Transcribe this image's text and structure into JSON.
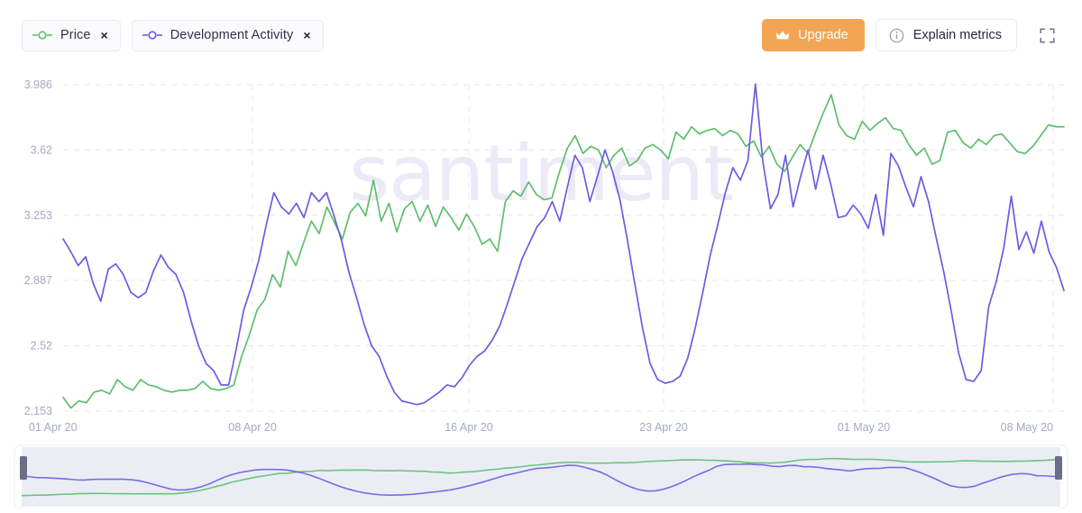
{
  "toolbar": {
    "chips": [
      {
        "label": "Price",
        "color": "#5fbe6e",
        "marker_icon": "line-point-icon",
        "close_icon": "close-icon",
        "close_label": "×"
      },
      {
        "label": "Development Activity",
        "color": "#6e5ce0",
        "marker_icon": "line-point-icon",
        "close_icon": "close-icon",
        "close_label": "×"
      }
    ],
    "upgrade": {
      "label": "Upgrade",
      "icon": "crown-icon",
      "bg": "#f2a455",
      "fg": "#ffffff"
    },
    "explain": {
      "label": "Explain metrics",
      "icon": "info-circle-icon"
    },
    "fullscreen": {
      "icon": "fullscreen-icon",
      "label": ""
    }
  },
  "watermark": "santiment",
  "chart_data": {
    "type": "line",
    "title": "",
    "xlabel": "",
    "ylabel": "",
    "grid": true,
    "legend_position": "top-left",
    "y_ticks": [
      "3.986",
      "3.62",
      "3.253",
      "2.887",
      "2.52",
      "2.153"
    ],
    "ylim": [
      2.153,
      3.986
    ],
    "x_ticks": [
      "01 Apr 20",
      "08 Apr 20",
      "16 Apr 20",
      "23 Apr 20",
      "01 May 20",
      "08 May 20"
    ],
    "x_tick_positions": [
      0,
      0.1892,
      0.4054,
      0.6,
      0.8,
      0.9892
    ],
    "series": [
      {
        "name": "Price",
        "color": "#5fbe6e",
        "values": [
          2.23,
          2.17,
          2.21,
          2.2,
          2.26,
          2.27,
          2.25,
          2.33,
          2.29,
          2.27,
          2.33,
          2.3,
          2.29,
          2.27,
          2.26,
          2.27,
          2.27,
          2.28,
          2.32,
          2.28,
          2.27,
          2.28,
          2.3,
          2.46,
          2.58,
          2.72,
          2.78,
          2.92,
          2.85,
          3.05,
          2.97,
          3.1,
          3.22,
          3.15,
          3.3,
          3.21,
          3.12,
          3.27,
          3.32,
          3.25,
          3.45,
          3.22,
          3.32,
          3.16,
          3.29,
          3.33,
          3.22,
          3.31,
          3.19,
          3.3,
          3.24,
          3.17,
          3.26,
          3.19,
          3.09,
          3.12,
          3.05,
          3.33,
          3.39,
          3.36,
          3.44,
          3.37,
          3.34,
          3.35,
          3.5,
          3.63,
          3.7,
          3.6,
          3.64,
          3.62,
          3.52,
          3.59,
          3.63,
          3.53,
          3.56,
          3.63,
          3.65,
          3.62,
          3.57,
          3.72,
          3.68,
          3.75,
          3.71,
          3.73,
          3.74,
          3.7,
          3.73,
          3.71,
          3.64,
          3.67,
          3.58,
          3.64,
          3.54,
          3.5,
          3.58,
          3.65,
          3.6,
          3.72,
          3.83,
          3.93,
          3.76,
          3.7,
          3.68,
          3.78,
          3.73,
          3.77,
          3.8,
          3.74,
          3.73,
          3.65,
          3.59,
          3.63,
          3.54,
          3.56,
          3.72,
          3.73,
          3.66,
          3.63,
          3.68,
          3.65,
          3.7,
          3.71,
          3.66,
          3.61,
          3.6,
          3.64,
          3.7,
          3.76,
          3.75,
          3.75
        ]
      },
      {
        "name": "Development Activity",
        "color": "#6e5ce0",
        "values": [
          3.12,
          3.05,
          2.97,
          3.02,
          2.87,
          2.77,
          2.95,
          2.98,
          2.92,
          2.82,
          2.79,
          2.82,
          2.94,
          3.03,
          2.96,
          2.92,
          2.82,
          2.66,
          2.52,
          2.42,
          2.38,
          2.3,
          2.3,
          2.5,
          2.72,
          2.85,
          3.0,
          3.2,
          3.38,
          3.3,
          3.26,
          3.32,
          3.24,
          3.38,
          3.33,
          3.38,
          3.25,
          3.11,
          2.93,
          2.79,
          2.64,
          2.52,
          2.46,
          2.35,
          2.26,
          2.21,
          2.2,
          2.19,
          2.2,
          2.23,
          2.26,
          2.3,
          2.29,
          2.34,
          2.41,
          2.46,
          2.49,
          2.55,
          2.63,
          2.75,
          2.88,
          3.01,
          3.1,
          3.19,
          3.24,
          3.33,
          3.22,
          3.41,
          3.59,
          3.52,
          3.33,
          3.47,
          3.62,
          3.5,
          3.34,
          3.11,
          2.86,
          2.62,
          2.42,
          2.33,
          2.31,
          2.32,
          2.35,
          2.45,
          2.62,
          2.82,
          3.03,
          3.2,
          3.38,
          3.52,
          3.45,
          3.56,
          3.99,
          3.55,
          3.29,
          3.37,
          3.59,
          3.3,
          3.47,
          3.62,
          3.4,
          3.59,
          3.43,
          3.24,
          3.25,
          3.31,
          3.26,
          3.18,
          3.37,
          3.14,
          3.6,
          3.53,
          3.41,
          3.3,
          3.47,
          3.33,
          3.13,
          2.94,
          2.72,
          2.48,
          2.33,
          2.32,
          2.38,
          2.74,
          2.88,
          3.07,
          3.36,
          3.06,
          3.16,
          3.04,
          3.22,
          3.05,
          2.96,
          2.83
        ]
      }
    ]
  },
  "navigator": {
    "selection_start_pct": 0,
    "selection_end_pct": 100,
    "left_handle": "navigator-left-handle",
    "right_handle": "navigator-right-handle",
    "track_color": "#e4e7f2"
  }
}
